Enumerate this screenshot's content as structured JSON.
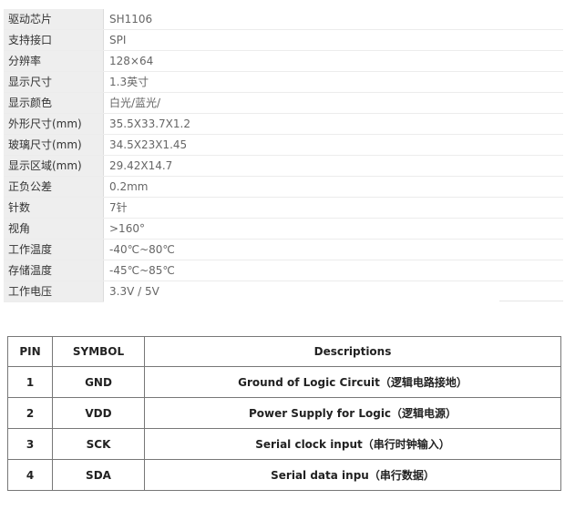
{
  "specs": [
    {
      "label": "驱动芯片",
      "value": "SH1106"
    },
    {
      "label": "支持接口",
      "value": "SPI"
    },
    {
      "label": "分辨率",
      "value": "128×64"
    },
    {
      "label": "显示尺寸",
      "value": "1.3英寸"
    },
    {
      "label": "显示颜色",
      "value": "白光/蓝光/"
    },
    {
      "label": "外形尺寸(mm)",
      "value": "35.5X33.7X1.2"
    },
    {
      "label": "玻璃尺寸(mm)",
      "value": "34.5X23X1.45"
    },
    {
      "label": "显示区域(mm)",
      "value": "29.42X14.7"
    },
    {
      "label": "正负公差",
      "value": "0.2mm"
    },
    {
      "label": "针数",
      "value": "7针"
    },
    {
      "label": "视角",
      "value": ">160°"
    },
    {
      "label": "工作温度",
      "value": "-40℃~80℃"
    },
    {
      "label": "存储温度",
      "value": "-45℃~85℃"
    },
    {
      "label": "工作电压",
      "value": "3.3V / 5V"
    }
  ],
  "pin_table": {
    "headers": [
      "PIN",
      "SYMBOL",
      "Descriptions"
    ],
    "rows": [
      {
        "pin": "1",
        "symbol": "GND",
        "desc": "Ground of Logic Circuit（逻辑电路接地）"
      },
      {
        "pin": "2",
        "symbol": "VDD",
        "desc": "Power Supply for Logic（逻辑电源）"
      },
      {
        "pin": "3",
        "symbol": "SCK",
        "desc": "Serial clock input（串行时钟输入）"
      },
      {
        "pin": "4",
        "symbol": "SDA",
        "desc": "Serial data inpu（串行数据）"
      }
    ]
  }
}
